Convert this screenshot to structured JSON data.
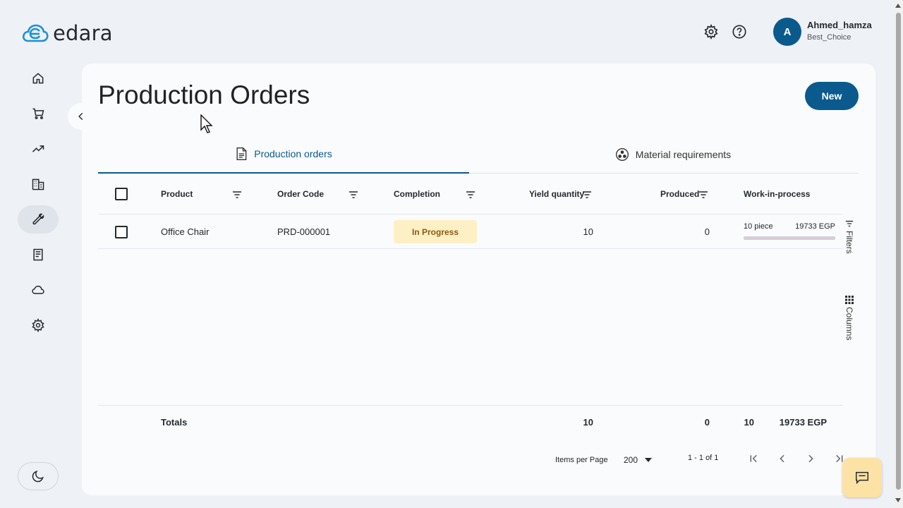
{
  "brand": {
    "name": "edara",
    "accent": "#0a5a8e"
  },
  "header": {
    "user_initial": "A",
    "user_name": "Ahmed_hamza",
    "user_company": "Best_Choice",
    "icons": [
      "gear-icon",
      "help-icon"
    ]
  },
  "sidebar": {
    "items": [
      {
        "name": "home-icon",
        "active": false
      },
      {
        "name": "cart-icon",
        "active": false
      },
      {
        "name": "trending-icon",
        "active": false
      },
      {
        "name": "building-icon",
        "active": false
      },
      {
        "name": "wrench-icon",
        "active": true
      },
      {
        "name": "receipt-icon",
        "active": false
      },
      {
        "name": "cloud-icon",
        "active": false
      },
      {
        "name": "settings-icon",
        "active": false
      }
    ],
    "theme_icon": "moon-icon"
  },
  "page": {
    "title": "Production Orders",
    "new_label": "New"
  },
  "tabs": [
    {
      "label": "Production orders",
      "icon": "document-icon",
      "active": true
    },
    {
      "label": "Material requirements",
      "icon": "materials-icon",
      "active": false
    }
  ],
  "table": {
    "columns": [
      "Product",
      "Order Code",
      "Completion",
      "Yield quantity",
      "Produced",
      "Work-in-process"
    ],
    "rows": [
      {
        "product": "Office Chair",
        "order_code": "PRD-000001",
        "completion": "In Progress",
        "yield_quantity": "10",
        "produced": "0",
        "wip_qty": "10 piece",
        "wip_value": "19733 EGP"
      }
    ],
    "totals": {
      "label": "Totals",
      "yield_quantity": "10",
      "produced": "0",
      "wip_qty": "10",
      "wip_value": "19733 EGP"
    }
  },
  "side_tools": {
    "filters": "Filters",
    "columns": "Columns"
  },
  "pagination": {
    "items_per_page_label": "Items per Page",
    "items_per_page": "200",
    "range": "1 - 1 of 1"
  }
}
